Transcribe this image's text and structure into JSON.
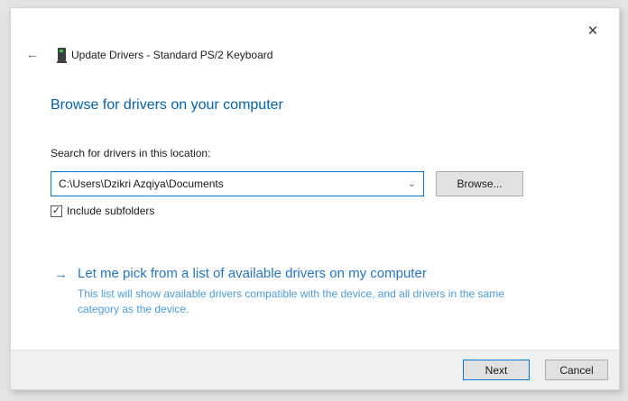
{
  "window": {
    "title": "Update Drivers - Standard PS/2 Keyboard"
  },
  "icons": {
    "close": "✕",
    "back": "←",
    "chevron_down": "⌄",
    "check": "✓",
    "arrow_right": "→"
  },
  "main": {
    "heading": "Browse for drivers on your computer",
    "search_label": "Search for drivers in this location:",
    "path_value": "C:\\Users\\Dzikri Azqiya\\Documents",
    "browse_label": "Browse...",
    "subfolders_label": "Include subfolders",
    "subfolders_checked": "true",
    "pick_link": {
      "label": "Let me pick from a list of available drivers on my computer",
      "description": "This list will show available drivers compatible with the device, and all drivers in the same\ncategory as the device."
    }
  },
  "footer": {
    "next_label": "Next",
    "cancel_label": "Cancel"
  },
  "colors": {
    "heading_blue": "#0063b1",
    "link_blue": "#2476c4",
    "link_description_blue": "#4a9ada",
    "focus_border_blue": "#0078d7",
    "device_light_green": "#37c837",
    "footer_gray": "#f0f0f0",
    "button_gray": "#e1e1e1"
  }
}
